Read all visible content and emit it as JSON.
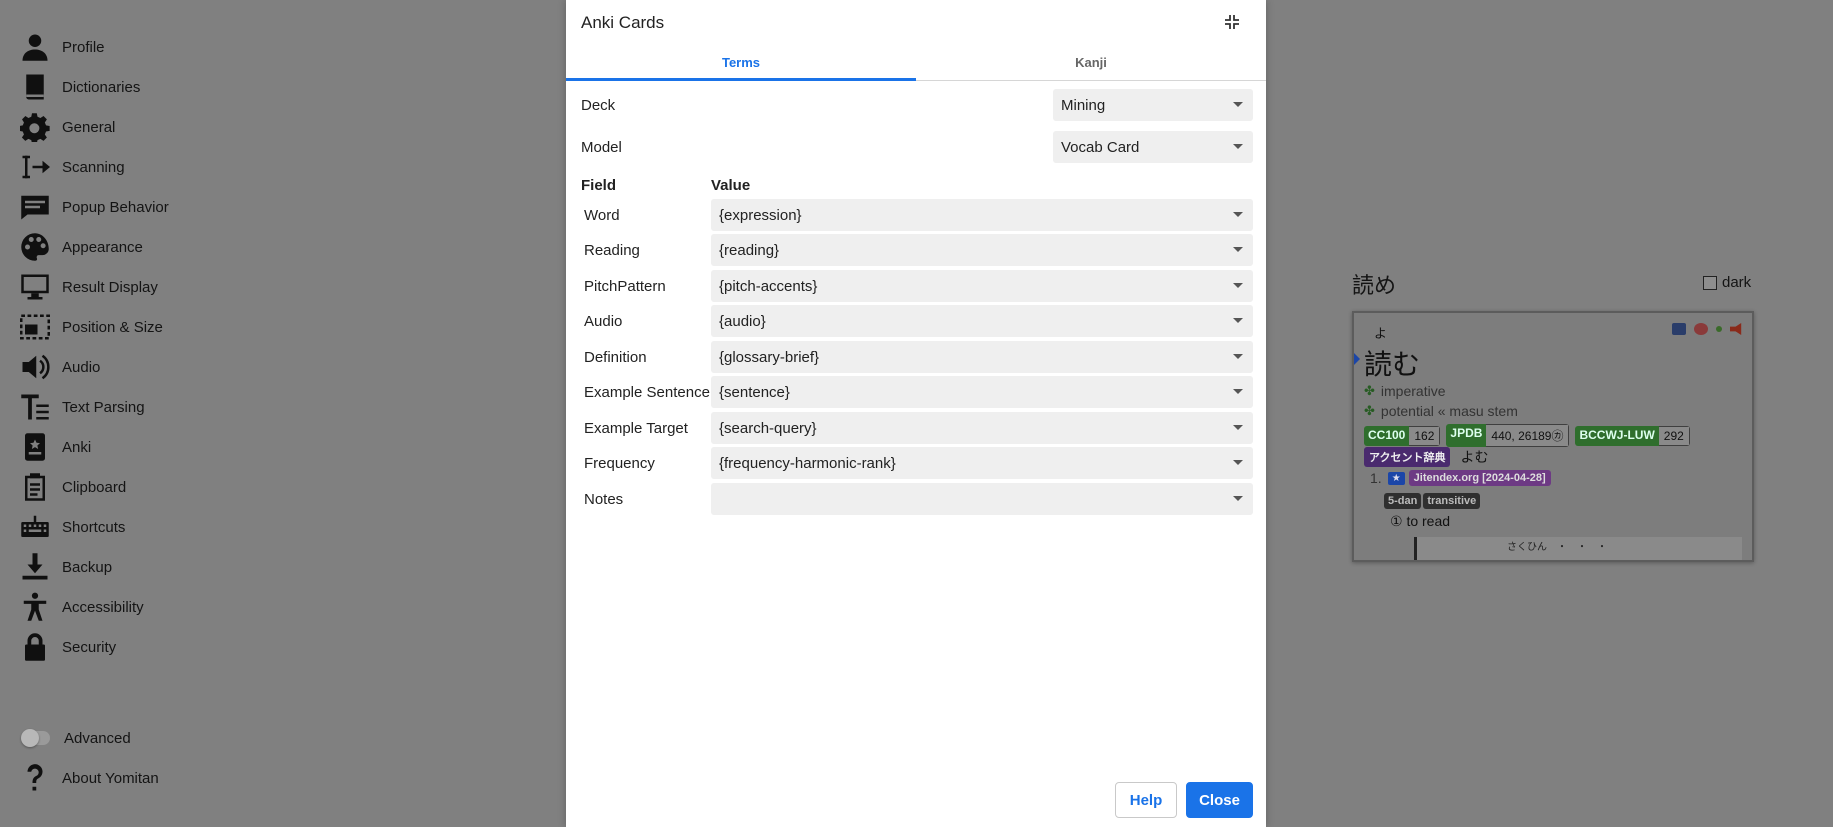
{
  "sidebar": {
    "items": [
      {
        "label": "Profile",
        "icon": "profile-icon"
      },
      {
        "label": "Dictionaries",
        "icon": "book-icon"
      },
      {
        "label": "General",
        "icon": "gear-icon"
      },
      {
        "label": "Scanning",
        "icon": "scanning-icon"
      },
      {
        "label": "Popup Behavior",
        "icon": "popup-icon"
      },
      {
        "label": "Appearance",
        "icon": "palette-icon"
      },
      {
        "label": "Result Display",
        "icon": "monitor-icon"
      },
      {
        "label": "Position & Size",
        "icon": "position-size-icon"
      },
      {
        "label": "Audio",
        "icon": "speaker-icon"
      },
      {
        "label": "Text Parsing",
        "icon": "text-parsing-icon"
      },
      {
        "label": "Anki",
        "icon": "anki-icon"
      },
      {
        "label": "Clipboard",
        "icon": "clipboard-icon"
      },
      {
        "label": "Shortcuts",
        "icon": "keyboard-icon"
      },
      {
        "label": "Backup",
        "icon": "download-icon"
      },
      {
        "label": "Accessibility",
        "icon": "accessibility-icon"
      },
      {
        "label": "Security",
        "icon": "lock-icon"
      }
    ],
    "advanced_label": "Advanced",
    "about_label": "About Yomitan"
  },
  "preview": {
    "title": "読め",
    "dark_label": "dark",
    "reading": "よ",
    "term": "読む",
    "inflection_1": "imperative",
    "inflection_2": "potential « masu stem",
    "freq": [
      {
        "k": "CC100",
        "v": "162"
      },
      {
        "k": "JPDB",
        "v": "440, 26189㋕"
      },
      {
        "k": "BCCWJ-LUW",
        "v": "292"
      }
    ],
    "pitch_dict": "アクセント辞典",
    "pitch_reading": "よむ",
    "def_number": "1.",
    "def_star": "★",
    "def_source": "Jitendex.org [2024-04-28]",
    "tag_1": "5-dan",
    "tag_2": "transitive",
    "gloss": "① to read",
    "example_fragment": "さくひん　・　・　・"
  },
  "modal": {
    "title": "Anki Cards",
    "tabs": [
      "Terms",
      "Kanji"
    ],
    "deck_label": "Deck",
    "deck_value": "Mining",
    "model_label": "Model",
    "model_value": "Vocab Card",
    "field_header": "Field",
    "value_header": "Value",
    "fields": [
      {
        "name": "Word",
        "value": "{expression}"
      },
      {
        "name": "Reading",
        "value": "{reading}"
      },
      {
        "name": "PitchPattern",
        "value": "{pitch-accents}"
      },
      {
        "name": "Audio",
        "value": "{audio}"
      },
      {
        "name": "Definition",
        "value": "{glossary-brief}"
      },
      {
        "name": "Example Sentence",
        "value": "{sentence}"
      },
      {
        "name": "Example Target",
        "value": "{search-query}"
      },
      {
        "name": "Frequency",
        "value": "{frequency-harmonic-rank}"
      },
      {
        "name": "Notes",
        "value": ""
      }
    ],
    "help_label": "Help",
    "close_label": "Close"
  },
  "colors": {
    "overlay": "#808080",
    "accent": "#1a73e8",
    "select_bg": "#efefef"
  }
}
